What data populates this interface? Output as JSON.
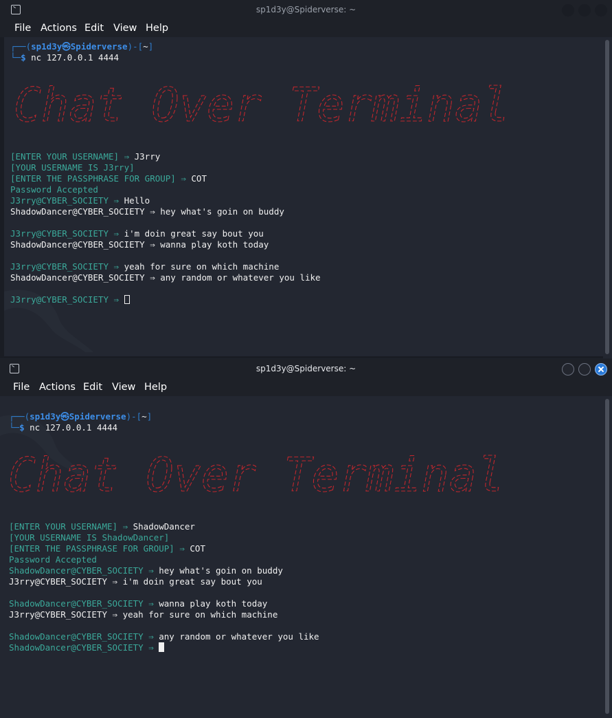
{
  "windows": [
    {
      "title": "sp1d3y@Spiderverse: ~",
      "menu": [
        "File",
        "Actions",
        "Edit",
        "View",
        "Help"
      ],
      "prompt": {
        "corner_top": "┌──(",
        "user": "sp1d3y",
        "at_glyph": "㉿",
        "host": "Spiderverse",
        "mid": ")-[",
        "path": "~",
        "end": "]",
        "corner_bottom": "└─",
        "dollar": "$",
        "command": "nc 127.0.0.1 4444"
      },
      "banner_text": "Chat Over Terminal",
      "session": [
        {
          "label": "[ENTER YOUR USERNAME] ⇒ ",
          "value": "J3rry"
        },
        {
          "label": "[YOUR USERNAME IS J3rry]",
          "value": ""
        },
        {
          "label": "[ENTER THE PASSPHRASE FOR GROUP] ⇒ ",
          "value": "COT"
        },
        {
          "label": "Password Accepted",
          "value": ""
        }
      ],
      "chat": [
        {
          "who": "J3rry@CYBER_SOCIETY ⇒ ",
          "text": "Hello",
          "self": true
        },
        {
          "who": "ShadowDancer@CYBER_SOCIETY ⇒ ",
          "text": "hey what's goin on buddy",
          "self": false
        },
        {
          "who": "J3rry@CYBER_SOCIETY ⇒ ",
          "text": "i'm doin great say bout you",
          "self": true
        },
        {
          "who": "ShadowDancer@CYBER_SOCIETY ⇒ ",
          "text": "wanna play koth today",
          "self": false
        },
        {
          "who": "J3rry@CYBER_SOCIETY ⇒ ",
          "text": "yeah for sure on which machine",
          "self": true
        },
        {
          "who": "ShadowDancer@CYBER_SOCIETY ⇒ ",
          "text": "any random or whatever you like",
          "self": false
        },
        {
          "who": "J3rry@CYBER_SOCIETY ⇒ ",
          "text": "",
          "self": true
        }
      ]
    },
    {
      "title": "sp1d3y@Spiderverse: ~",
      "menu": [
        "File",
        "Actions",
        "Edit",
        "View",
        "Help"
      ],
      "prompt": {
        "corner_top": "┌──(",
        "user": "sp1d3y",
        "at_glyph": "㉿",
        "host": "Spiderverse",
        "mid": ")-[",
        "path": "~",
        "end": "]",
        "corner_bottom": "└─",
        "dollar": "$",
        "command": "nc 127.0.0.1 4444"
      },
      "banner_text": "Chat Over Terminal",
      "session": [
        {
          "label": "[ENTER YOUR USERNAME] ⇒ ",
          "value": "ShadowDancer"
        },
        {
          "label": "[YOUR USERNAME IS ShadowDancer]",
          "value": ""
        },
        {
          "label": "[ENTER THE PASSPHRASE FOR GROUP] ⇒ ",
          "value": "COT"
        },
        {
          "label": "Password Accepted",
          "value": ""
        }
      ],
      "chat": [
        {
          "who": "ShadowDancer@CYBER_SOCIETY ⇒ ",
          "text": "hey what's goin on buddy",
          "self": true
        },
        {
          "who": "J3rry@CYBER_SOCIETY ⇒ ",
          "text": "i'm doin great say bout you",
          "self": false
        },
        {
          "who": "ShadowDancer@CYBER_SOCIETY ⇒ ",
          "text": "wanna play koth today",
          "self": true
        },
        {
          "who": "J3rry@CYBER_SOCIETY ⇒ ",
          "text": "yeah for sure on which machine",
          "self": false
        },
        {
          "who": "ShadowDancer@CYBER_SOCIETY ⇒ ",
          "text": "any random or whatever you like",
          "self": true
        },
        {
          "who": "ShadowDancer@CYBER_SOCIETY ⇒ ",
          "text": "",
          "self": true
        }
      ]
    }
  ],
  "colors": {
    "banner_red": "#c2272d",
    "teal": "#3ba99a",
    "prompt_blue": "#3d8ee8",
    "close_blue": "#2a7ad8"
  },
  "icons": {
    "titlebar": "terminal-icon",
    "close": "close-icon",
    "minimize": "minimize-icon",
    "maximize": "maximize-icon",
    "wallpaper": "kali-dragon-icon"
  }
}
